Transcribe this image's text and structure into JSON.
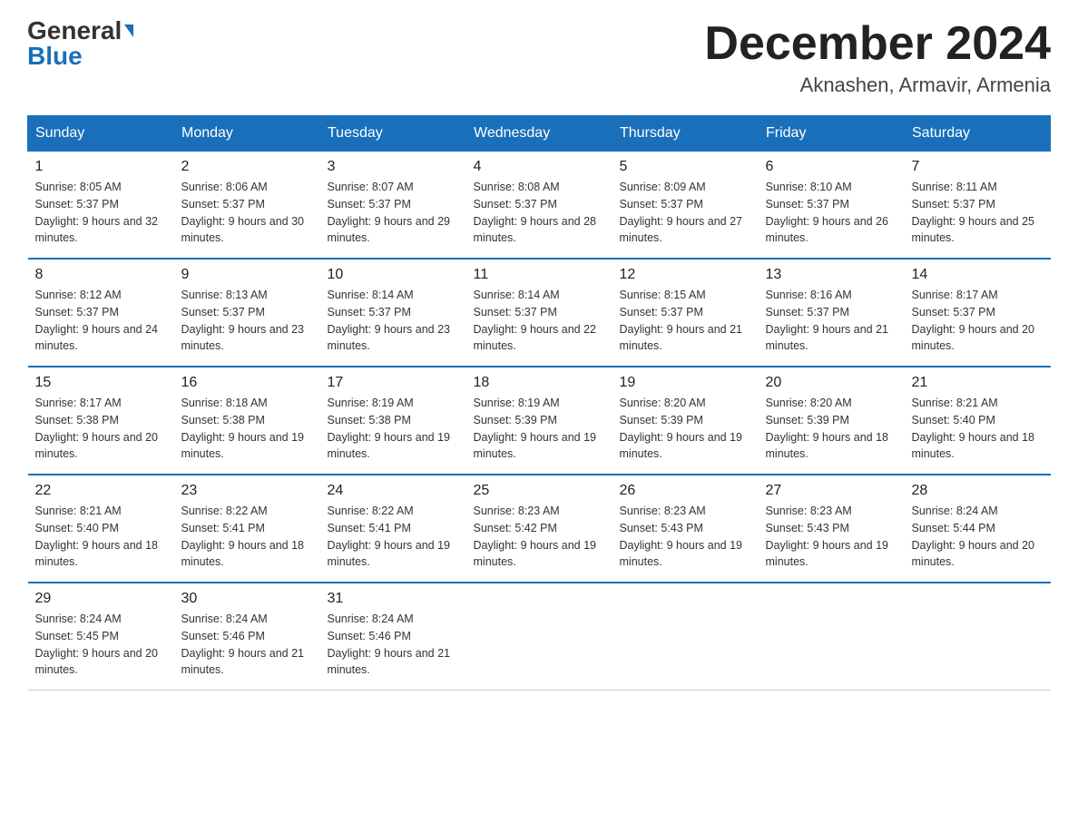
{
  "header": {
    "logo_general": "General",
    "logo_blue": "Blue",
    "month_title": "December 2024",
    "location": "Aknashen, Armavir, Armenia"
  },
  "weekdays": [
    "Sunday",
    "Monday",
    "Tuesday",
    "Wednesday",
    "Thursday",
    "Friday",
    "Saturday"
  ],
  "weeks": [
    [
      {
        "day": "1",
        "sunrise": "8:05 AM",
        "sunset": "5:37 PM",
        "daylight": "9 hours and 32 minutes."
      },
      {
        "day": "2",
        "sunrise": "8:06 AM",
        "sunset": "5:37 PM",
        "daylight": "9 hours and 30 minutes."
      },
      {
        "day": "3",
        "sunrise": "8:07 AM",
        "sunset": "5:37 PM",
        "daylight": "9 hours and 29 minutes."
      },
      {
        "day": "4",
        "sunrise": "8:08 AM",
        "sunset": "5:37 PM",
        "daylight": "9 hours and 28 minutes."
      },
      {
        "day": "5",
        "sunrise": "8:09 AM",
        "sunset": "5:37 PM",
        "daylight": "9 hours and 27 minutes."
      },
      {
        "day": "6",
        "sunrise": "8:10 AM",
        "sunset": "5:37 PM",
        "daylight": "9 hours and 26 minutes."
      },
      {
        "day": "7",
        "sunrise": "8:11 AM",
        "sunset": "5:37 PM",
        "daylight": "9 hours and 25 minutes."
      }
    ],
    [
      {
        "day": "8",
        "sunrise": "8:12 AM",
        "sunset": "5:37 PM",
        "daylight": "9 hours and 24 minutes."
      },
      {
        "day": "9",
        "sunrise": "8:13 AM",
        "sunset": "5:37 PM",
        "daylight": "9 hours and 23 minutes."
      },
      {
        "day": "10",
        "sunrise": "8:14 AM",
        "sunset": "5:37 PM",
        "daylight": "9 hours and 23 minutes."
      },
      {
        "day": "11",
        "sunrise": "8:14 AM",
        "sunset": "5:37 PM",
        "daylight": "9 hours and 22 minutes."
      },
      {
        "day": "12",
        "sunrise": "8:15 AM",
        "sunset": "5:37 PM",
        "daylight": "9 hours and 21 minutes."
      },
      {
        "day": "13",
        "sunrise": "8:16 AM",
        "sunset": "5:37 PM",
        "daylight": "9 hours and 21 minutes."
      },
      {
        "day": "14",
        "sunrise": "8:17 AM",
        "sunset": "5:37 PM",
        "daylight": "9 hours and 20 minutes."
      }
    ],
    [
      {
        "day": "15",
        "sunrise": "8:17 AM",
        "sunset": "5:38 PM",
        "daylight": "9 hours and 20 minutes."
      },
      {
        "day": "16",
        "sunrise": "8:18 AM",
        "sunset": "5:38 PM",
        "daylight": "9 hours and 19 minutes."
      },
      {
        "day": "17",
        "sunrise": "8:19 AM",
        "sunset": "5:38 PM",
        "daylight": "9 hours and 19 minutes."
      },
      {
        "day": "18",
        "sunrise": "8:19 AM",
        "sunset": "5:39 PM",
        "daylight": "9 hours and 19 minutes."
      },
      {
        "day": "19",
        "sunrise": "8:20 AM",
        "sunset": "5:39 PM",
        "daylight": "9 hours and 19 minutes."
      },
      {
        "day": "20",
        "sunrise": "8:20 AM",
        "sunset": "5:39 PM",
        "daylight": "9 hours and 18 minutes."
      },
      {
        "day": "21",
        "sunrise": "8:21 AM",
        "sunset": "5:40 PM",
        "daylight": "9 hours and 18 minutes."
      }
    ],
    [
      {
        "day": "22",
        "sunrise": "8:21 AM",
        "sunset": "5:40 PM",
        "daylight": "9 hours and 18 minutes."
      },
      {
        "day": "23",
        "sunrise": "8:22 AM",
        "sunset": "5:41 PM",
        "daylight": "9 hours and 18 minutes."
      },
      {
        "day": "24",
        "sunrise": "8:22 AM",
        "sunset": "5:41 PM",
        "daylight": "9 hours and 19 minutes."
      },
      {
        "day": "25",
        "sunrise": "8:23 AM",
        "sunset": "5:42 PM",
        "daylight": "9 hours and 19 minutes."
      },
      {
        "day": "26",
        "sunrise": "8:23 AM",
        "sunset": "5:43 PM",
        "daylight": "9 hours and 19 minutes."
      },
      {
        "day": "27",
        "sunrise": "8:23 AM",
        "sunset": "5:43 PM",
        "daylight": "9 hours and 19 minutes."
      },
      {
        "day": "28",
        "sunrise": "8:24 AM",
        "sunset": "5:44 PM",
        "daylight": "9 hours and 20 minutes."
      }
    ],
    [
      {
        "day": "29",
        "sunrise": "8:24 AM",
        "sunset": "5:45 PM",
        "daylight": "9 hours and 20 minutes."
      },
      {
        "day": "30",
        "sunrise": "8:24 AM",
        "sunset": "5:46 PM",
        "daylight": "9 hours and 21 minutes."
      },
      {
        "day": "31",
        "sunrise": "8:24 AM",
        "sunset": "5:46 PM",
        "daylight": "9 hours and 21 minutes."
      },
      null,
      null,
      null,
      null
    ]
  ]
}
